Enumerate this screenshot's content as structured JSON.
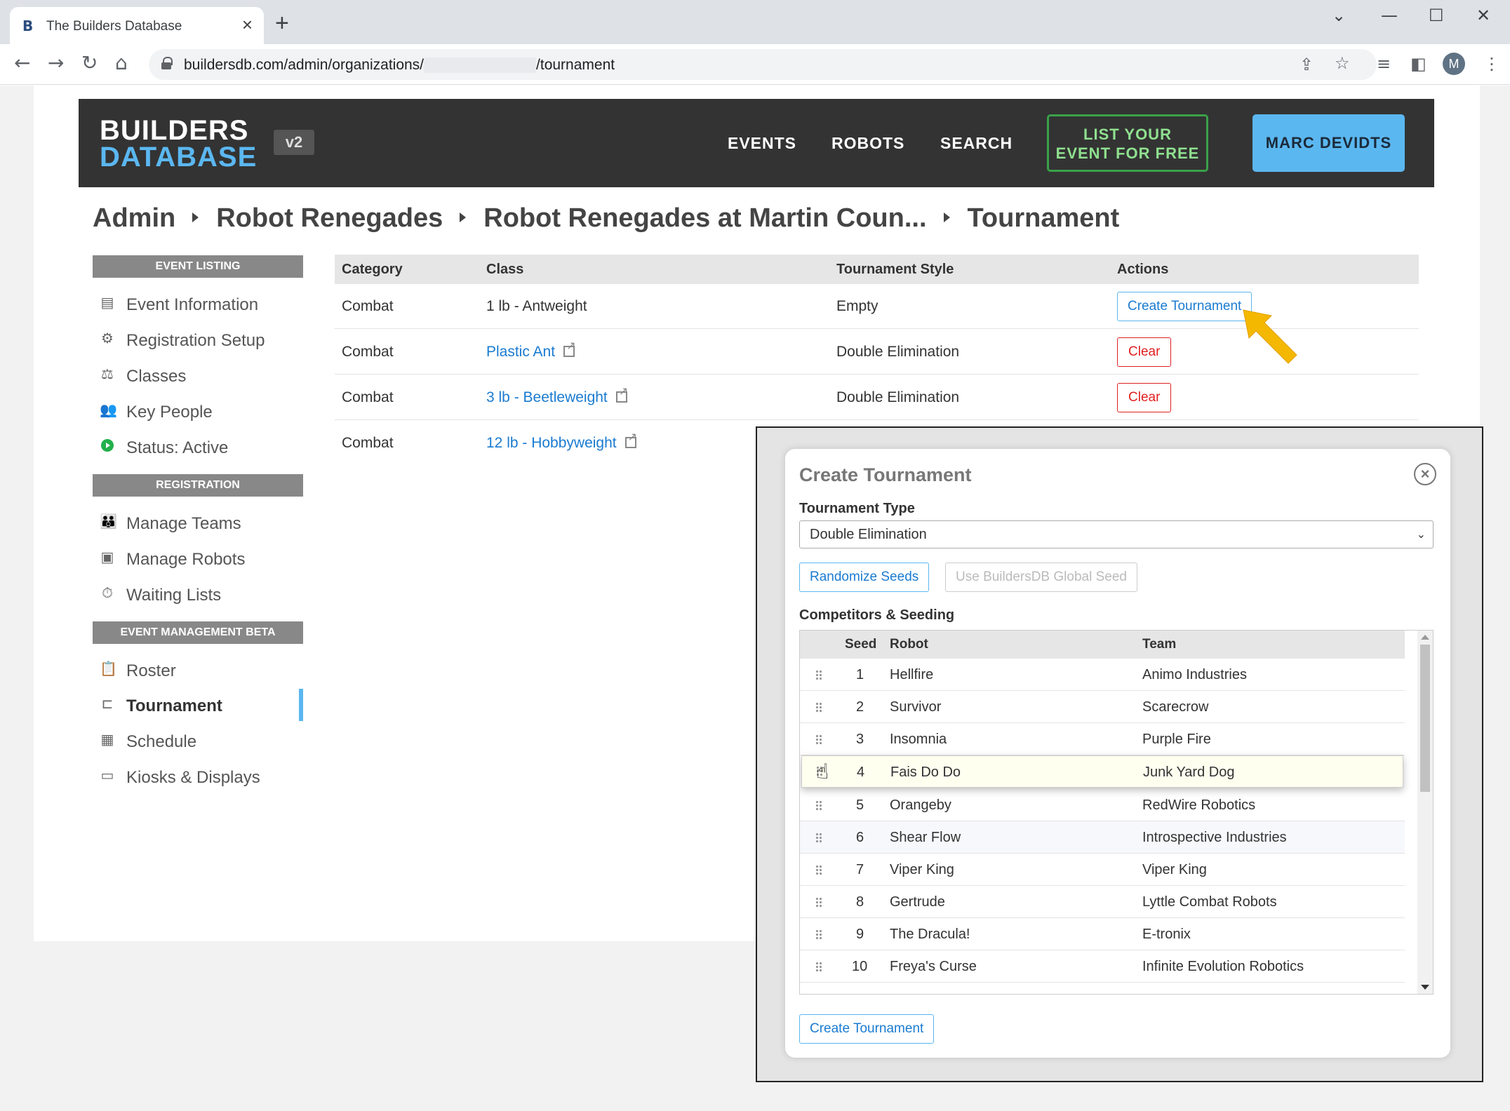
{
  "browser": {
    "tab_title": "The Builders Database",
    "favicon": "B",
    "url_prefix": "buildersdb.com/admin/organizations/",
    "url_suffix": "/tournament",
    "avatar_initial": "M"
  },
  "header": {
    "logo_line1": "BUILDERS",
    "logo_line2": "DATABASE",
    "version": "v2",
    "nav": [
      "EVENTS",
      "ROBOTS",
      "SEARCH"
    ],
    "list_event_line1": "LIST YOUR",
    "list_event_line2": "EVENT FOR FREE",
    "user_name": "MARC DEVIDTS"
  },
  "breadcrumb": [
    "Admin",
    "Robot Renegades",
    "Robot Renegades at Martin Coun...",
    "Tournament"
  ],
  "sidebar": {
    "sections": [
      {
        "title": "EVENT LISTING",
        "items": [
          {
            "label": "Event Information",
            "icon": "list-icon"
          },
          {
            "label": "Registration Setup",
            "icon": "gear-icon"
          },
          {
            "label": "Classes",
            "icon": "scale-icon"
          },
          {
            "label": "Key People",
            "icon": "people-icon"
          },
          {
            "label": "Status: Active",
            "icon": "status-active-icon"
          }
        ]
      },
      {
        "title": "REGISTRATION",
        "items": [
          {
            "label": "Manage Teams",
            "icon": "team-icon"
          },
          {
            "label": "Manage Robots",
            "icon": "robot-icon"
          },
          {
            "label": "Waiting Lists",
            "icon": "stopwatch-icon"
          }
        ]
      },
      {
        "title": "EVENT MANAGEMENT BETA",
        "items": [
          {
            "label": "Roster",
            "icon": "clipboard-icon"
          },
          {
            "label": "Tournament",
            "icon": "bracket-icon"
          },
          {
            "label": "Schedule",
            "icon": "calendar-icon"
          },
          {
            "label": "Kiosks & Displays",
            "icon": "monitor-icon"
          }
        ]
      }
    ]
  },
  "classes_table": {
    "headers": [
      "Category",
      "Class",
      "Tournament Style",
      "Actions"
    ],
    "rows": [
      {
        "category": "Combat",
        "class": "1 lb - Antweight",
        "style": "Empty",
        "action": "Create Tournament"
      },
      {
        "category": "Combat",
        "class": "Plastic Ant",
        "style": "Double Elimination",
        "action": "Clear"
      },
      {
        "category": "Combat",
        "class": "3 lb - Beetleweight",
        "style": "Double Elimination",
        "action": "Clear"
      },
      {
        "category": "Combat",
        "class": "12 lb - Hobbyweight",
        "style": "",
        "action": ""
      }
    ]
  },
  "modal": {
    "title": "Create Tournament",
    "type_label": "Tournament Type",
    "type_value": "Double Elimination",
    "randomize_label": "Randomize Seeds",
    "global_seed_label": "Use BuildersDB Global Seed",
    "competitors_label": "Competitors & Seeding",
    "seed_headers": [
      "Seed",
      "Robot",
      "Team"
    ],
    "seeds": [
      {
        "seed": "1",
        "robot": "Hellfire",
        "team": "Animo Industries"
      },
      {
        "seed": "2",
        "robot": "Survivor",
        "team": "Scarecrow"
      },
      {
        "seed": "3",
        "robot": "Insomnia",
        "team": "Purple Fire"
      },
      {
        "seed": "4",
        "robot": "Fais Do Do",
        "team": "Junk Yard Dog"
      },
      {
        "seed": "5",
        "robot": "Orangeby",
        "team": "RedWire Robotics"
      },
      {
        "seed": "6",
        "robot": "Shear Flow",
        "team": "Introspective Industries"
      },
      {
        "seed": "7",
        "robot": "Viper King",
        "team": "Viper King"
      },
      {
        "seed": "8",
        "robot": "Gertrude",
        "team": "Lyttle Combat Robots"
      },
      {
        "seed": "9",
        "robot": "The Dracula!",
        "team": "E-tronix"
      },
      {
        "seed": "10",
        "robot": "Freya's Curse",
        "team": "Infinite Evolution Robotics"
      }
    ],
    "submit_label": "Create Tournament"
  },
  "colors": {
    "accent": "#5bb7f0",
    "link": "#1a7bd1",
    "danger": "#e02020",
    "header_bg": "#333333",
    "arrow": "#f5b800"
  }
}
